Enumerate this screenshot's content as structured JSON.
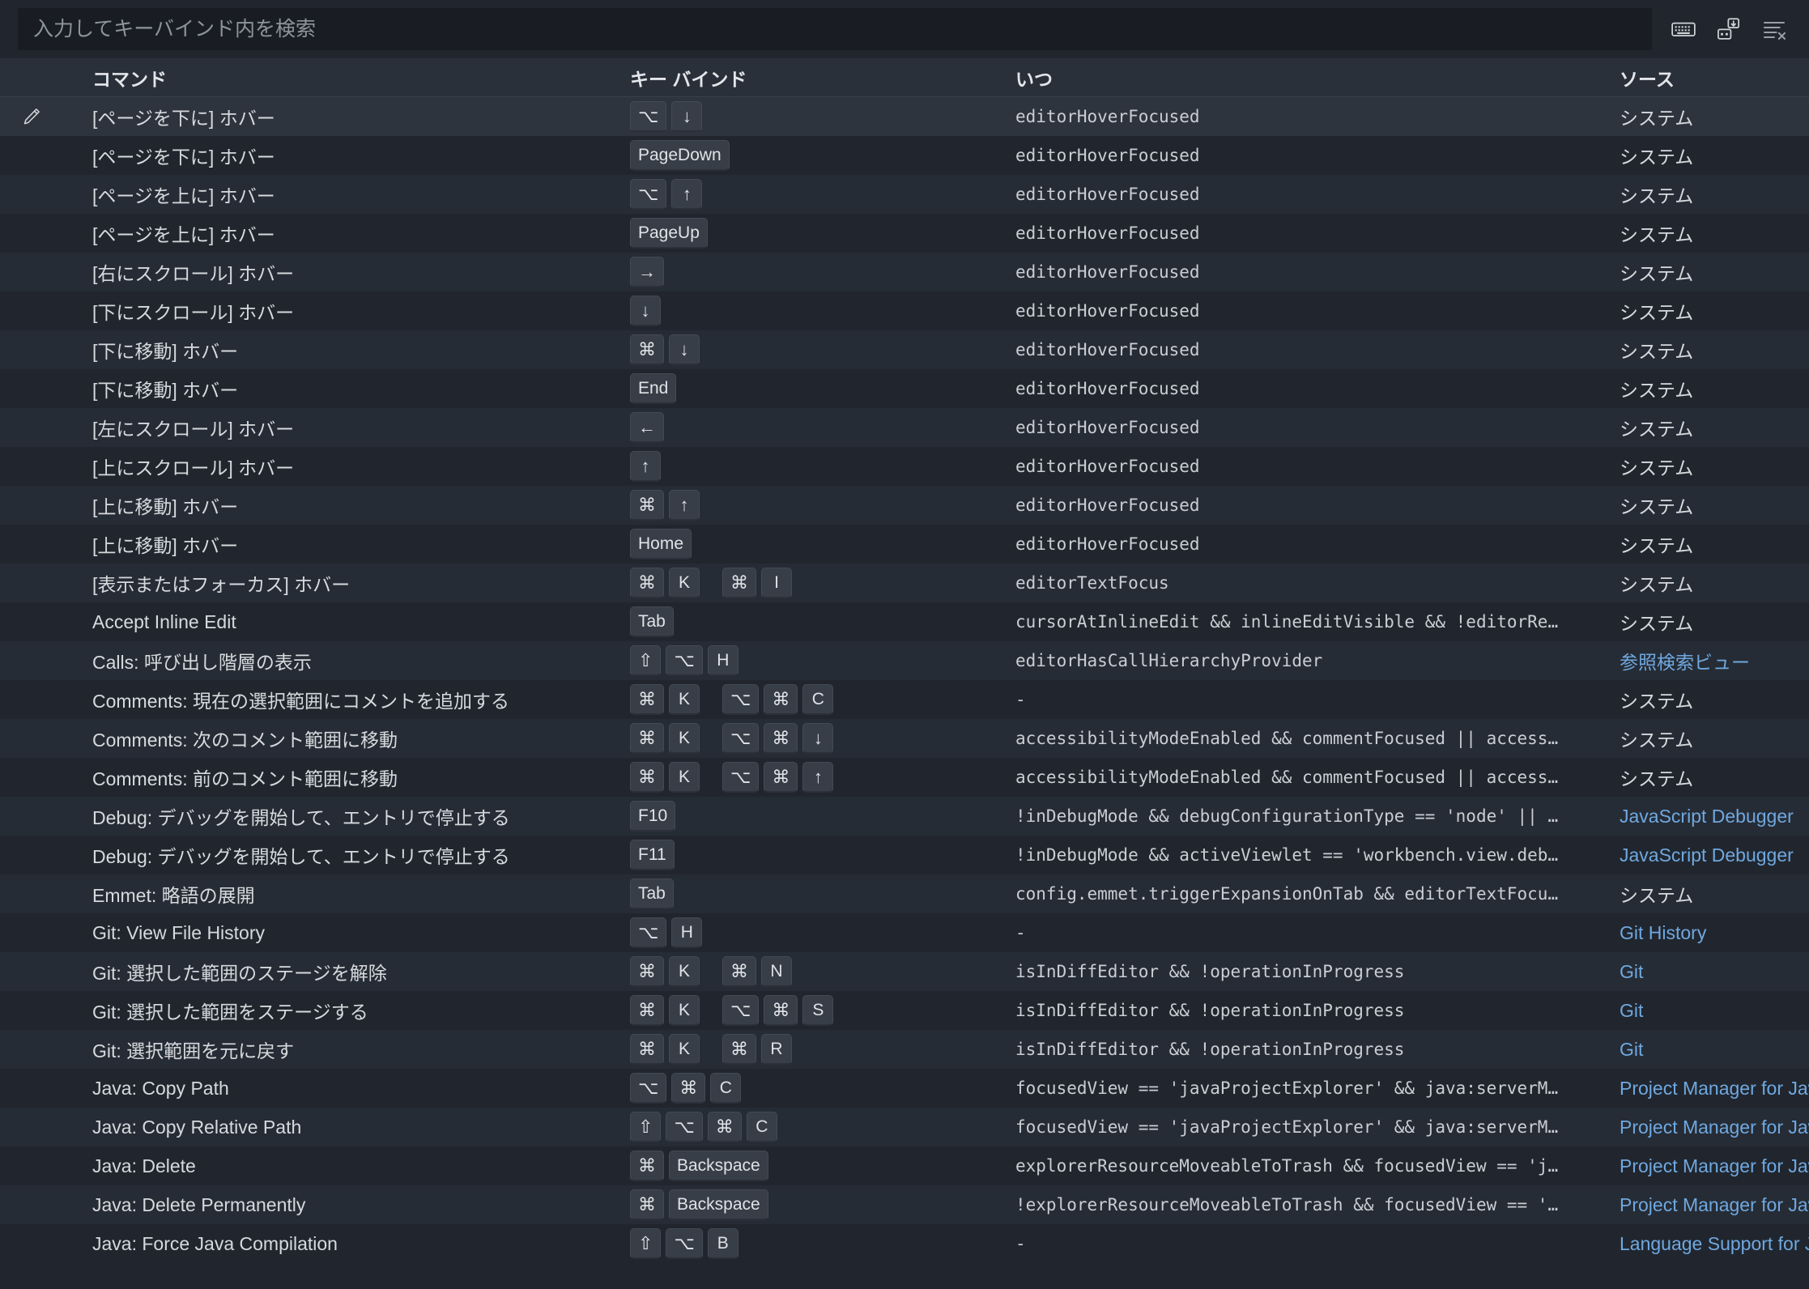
{
  "search": {
    "placeholder": "入力してキーバインド内を検索",
    "value": ""
  },
  "toolbar": {
    "icons": [
      {
        "name": "keyboard-icon",
        "title": "キーボード ショートカットの記録"
      },
      {
        "name": "record-keys-icon",
        "title": "キーの記録"
      },
      {
        "name": "clear-filter-icon",
        "title": "キーバインド検索のクリア"
      }
    ]
  },
  "table": {
    "headers": {
      "command": "コマンド",
      "keybinding": "キー バインド",
      "when": "いつ",
      "source": "ソース"
    },
    "colors": {
      "link": "#6fa8e0",
      "row_odd": "#262c35",
      "row_even": "#21262e",
      "row_selected": "#2e343e",
      "header_bg": "#2a303a"
    },
    "rows": [
      {
        "edit": true,
        "command": "[ページを下に] ホバー",
        "keys": [
          [
            "⌥",
            "↓"
          ]
        ],
        "when": "editorHoverFocused",
        "source": "システム",
        "source_link": false
      },
      {
        "edit": false,
        "command": "[ページを下に] ホバー",
        "keys": [
          [
            "PageDown"
          ]
        ],
        "when": "editorHoverFocused",
        "source": "システム",
        "source_link": false
      },
      {
        "edit": false,
        "command": "[ページを上に] ホバー",
        "keys": [
          [
            "⌥",
            "↑"
          ]
        ],
        "when": "editorHoverFocused",
        "source": "システム",
        "source_link": false
      },
      {
        "edit": false,
        "command": "[ページを上に] ホバー",
        "keys": [
          [
            "PageUp"
          ]
        ],
        "when": "editorHoverFocused",
        "source": "システム",
        "source_link": false
      },
      {
        "edit": false,
        "command": "[右にスクロール] ホバー",
        "keys": [
          [
            "→"
          ]
        ],
        "when": "editorHoverFocused",
        "source": "システム",
        "source_link": false
      },
      {
        "edit": false,
        "command": "[下にスクロール] ホバー",
        "keys": [
          [
            "↓"
          ]
        ],
        "when": "editorHoverFocused",
        "source": "システム",
        "source_link": false
      },
      {
        "edit": false,
        "command": "[下に移動] ホバー",
        "keys": [
          [
            "⌘",
            "↓"
          ]
        ],
        "when": "editorHoverFocused",
        "source": "システム",
        "source_link": false
      },
      {
        "edit": false,
        "command": "[下に移動] ホバー",
        "keys": [
          [
            "End"
          ]
        ],
        "when": "editorHoverFocused",
        "source": "システム",
        "source_link": false
      },
      {
        "edit": false,
        "command": "[左にスクロール] ホバー",
        "keys": [
          [
            "←"
          ]
        ],
        "when": "editorHoverFocused",
        "source": "システム",
        "source_link": false
      },
      {
        "edit": false,
        "command": "[上にスクロール] ホバー",
        "keys": [
          [
            "↑"
          ]
        ],
        "when": "editorHoverFocused",
        "source": "システム",
        "source_link": false
      },
      {
        "edit": false,
        "command": "[上に移動] ホバー",
        "keys": [
          [
            "⌘",
            "↑"
          ]
        ],
        "when": "editorHoverFocused",
        "source": "システム",
        "source_link": false
      },
      {
        "edit": false,
        "command": "[上に移動] ホバー",
        "keys": [
          [
            "Home"
          ]
        ],
        "when": "editorHoverFocused",
        "source": "システム",
        "source_link": false
      },
      {
        "edit": false,
        "command": "[表示またはフォーカス] ホバー",
        "keys": [
          [
            "⌘",
            "K"
          ],
          [
            "⌘",
            "I"
          ]
        ],
        "when": "editorTextFocus",
        "source": "システム",
        "source_link": false
      },
      {
        "edit": false,
        "command": "Accept Inline Edit",
        "keys": [
          [
            "Tab"
          ]
        ],
        "when": "cursorAtInlineEdit && inlineEditVisible && !editorRe…",
        "source": "システム",
        "source_link": false
      },
      {
        "edit": false,
        "command": "Calls: 呼び出し階層の表示",
        "keys": [
          [
            "⇧",
            "⌥",
            "H"
          ]
        ],
        "when": "editorHasCallHierarchyProvider",
        "source": "参照検索ビュー",
        "source_link": true
      },
      {
        "edit": false,
        "command": "Comments: 現在の選択範囲にコメントを追加する",
        "keys": [
          [
            "⌘",
            "K"
          ],
          [
            "⌥",
            "⌘",
            "C"
          ]
        ],
        "when": "-",
        "source": "システム",
        "source_link": false
      },
      {
        "edit": false,
        "command": "Comments: 次のコメント範囲に移動",
        "keys": [
          [
            "⌘",
            "K"
          ],
          [
            "⌥",
            "⌘",
            "↓"
          ]
        ],
        "when": "accessibilityModeEnabled && commentFocused || access…",
        "source": "システム",
        "source_link": false
      },
      {
        "edit": false,
        "command": "Comments: 前のコメント範囲に移動",
        "keys": [
          [
            "⌘",
            "K"
          ],
          [
            "⌥",
            "⌘",
            "↑"
          ]
        ],
        "when": "accessibilityModeEnabled && commentFocused || access…",
        "source": "システム",
        "source_link": false
      },
      {
        "edit": false,
        "command": "Debug: デバッグを開始して、エントリで停止する",
        "keys": [
          [
            "F10"
          ]
        ],
        "when": "!inDebugMode && debugConfigurationType == 'node' || …",
        "source": "JavaScript Debugger",
        "source_link": true
      },
      {
        "edit": false,
        "command": "Debug: デバッグを開始して、エントリで停止する",
        "keys": [
          [
            "F11"
          ]
        ],
        "when": "!inDebugMode && activeViewlet == 'workbench.view.deb…",
        "source": "JavaScript Debugger",
        "source_link": true
      },
      {
        "edit": false,
        "command": "Emmet: 略語の展開",
        "keys": [
          [
            "Tab"
          ]
        ],
        "when": "config.emmet.triggerExpansionOnTab && editorTextFocu…",
        "source": "システム",
        "source_link": false
      },
      {
        "edit": false,
        "command": "Git: View File History",
        "keys": [
          [
            "⌥",
            "H"
          ]
        ],
        "when": "-",
        "source": "Git History",
        "source_link": true
      },
      {
        "edit": false,
        "command": "Git: 選択した範囲のステージを解除",
        "keys": [
          [
            "⌘",
            "K"
          ],
          [
            "⌘",
            "N"
          ]
        ],
        "when": "isInDiffEditor && !operationInProgress",
        "source": "Git",
        "source_link": true
      },
      {
        "edit": false,
        "command": "Git: 選択した範囲をステージする",
        "keys": [
          [
            "⌘",
            "K"
          ],
          [
            "⌥",
            "⌘",
            "S"
          ]
        ],
        "when": "isInDiffEditor && !operationInProgress",
        "source": "Git",
        "source_link": true
      },
      {
        "edit": false,
        "command": "Git: 選択範囲を元に戻す",
        "keys": [
          [
            "⌘",
            "K"
          ],
          [
            "⌘",
            "R"
          ]
        ],
        "when": "isInDiffEditor && !operationInProgress",
        "source": "Git",
        "source_link": true
      },
      {
        "edit": false,
        "command": "Java: Copy Path",
        "keys": [
          [
            "⌥",
            "⌘",
            "C"
          ]
        ],
        "when": "focusedView == 'javaProjectExplorer' && java:serverM…",
        "source": "Project Manager for Java",
        "source_link": true
      },
      {
        "edit": false,
        "command": "Java: Copy Relative Path",
        "keys": [
          [
            "⇧",
            "⌥",
            "⌘",
            "C"
          ]
        ],
        "when": "focusedView == 'javaProjectExplorer' && java:serverM…",
        "source": "Project Manager for Java",
        "source_link": true
      },
      {
        "edit": false,
        "command": "Java: Delete",
        "keys": [
          [
            "⌘",
            "Backspace"
          ]
        ],
        "when": "explorerResourceMoveableToTrash && focusedView == 'j…",
        "source": "Project Manager for Java",
        "source_link": true
      },
      {
        "edit": false,
        "command": "Java: Delete Permanently",
        "keys": [
          [
            "⌘",
            "Backspace"
          ]
        ],
        "when": "!explorerResourceMoveableToTrash && focusedView == '…",
        "source": "Project Manager for Java",
        "source_link": true
      },
      {
        "edit": false,
        "command": "Java: Force Java Compilation",
        "keys": [
          [
            "⇧",
            "⌥",
            "B"
          ]
        ],
        "when": "-",
        "source": "Language Support for Java",
        "source_link": true
      }
    ]
  }
}
